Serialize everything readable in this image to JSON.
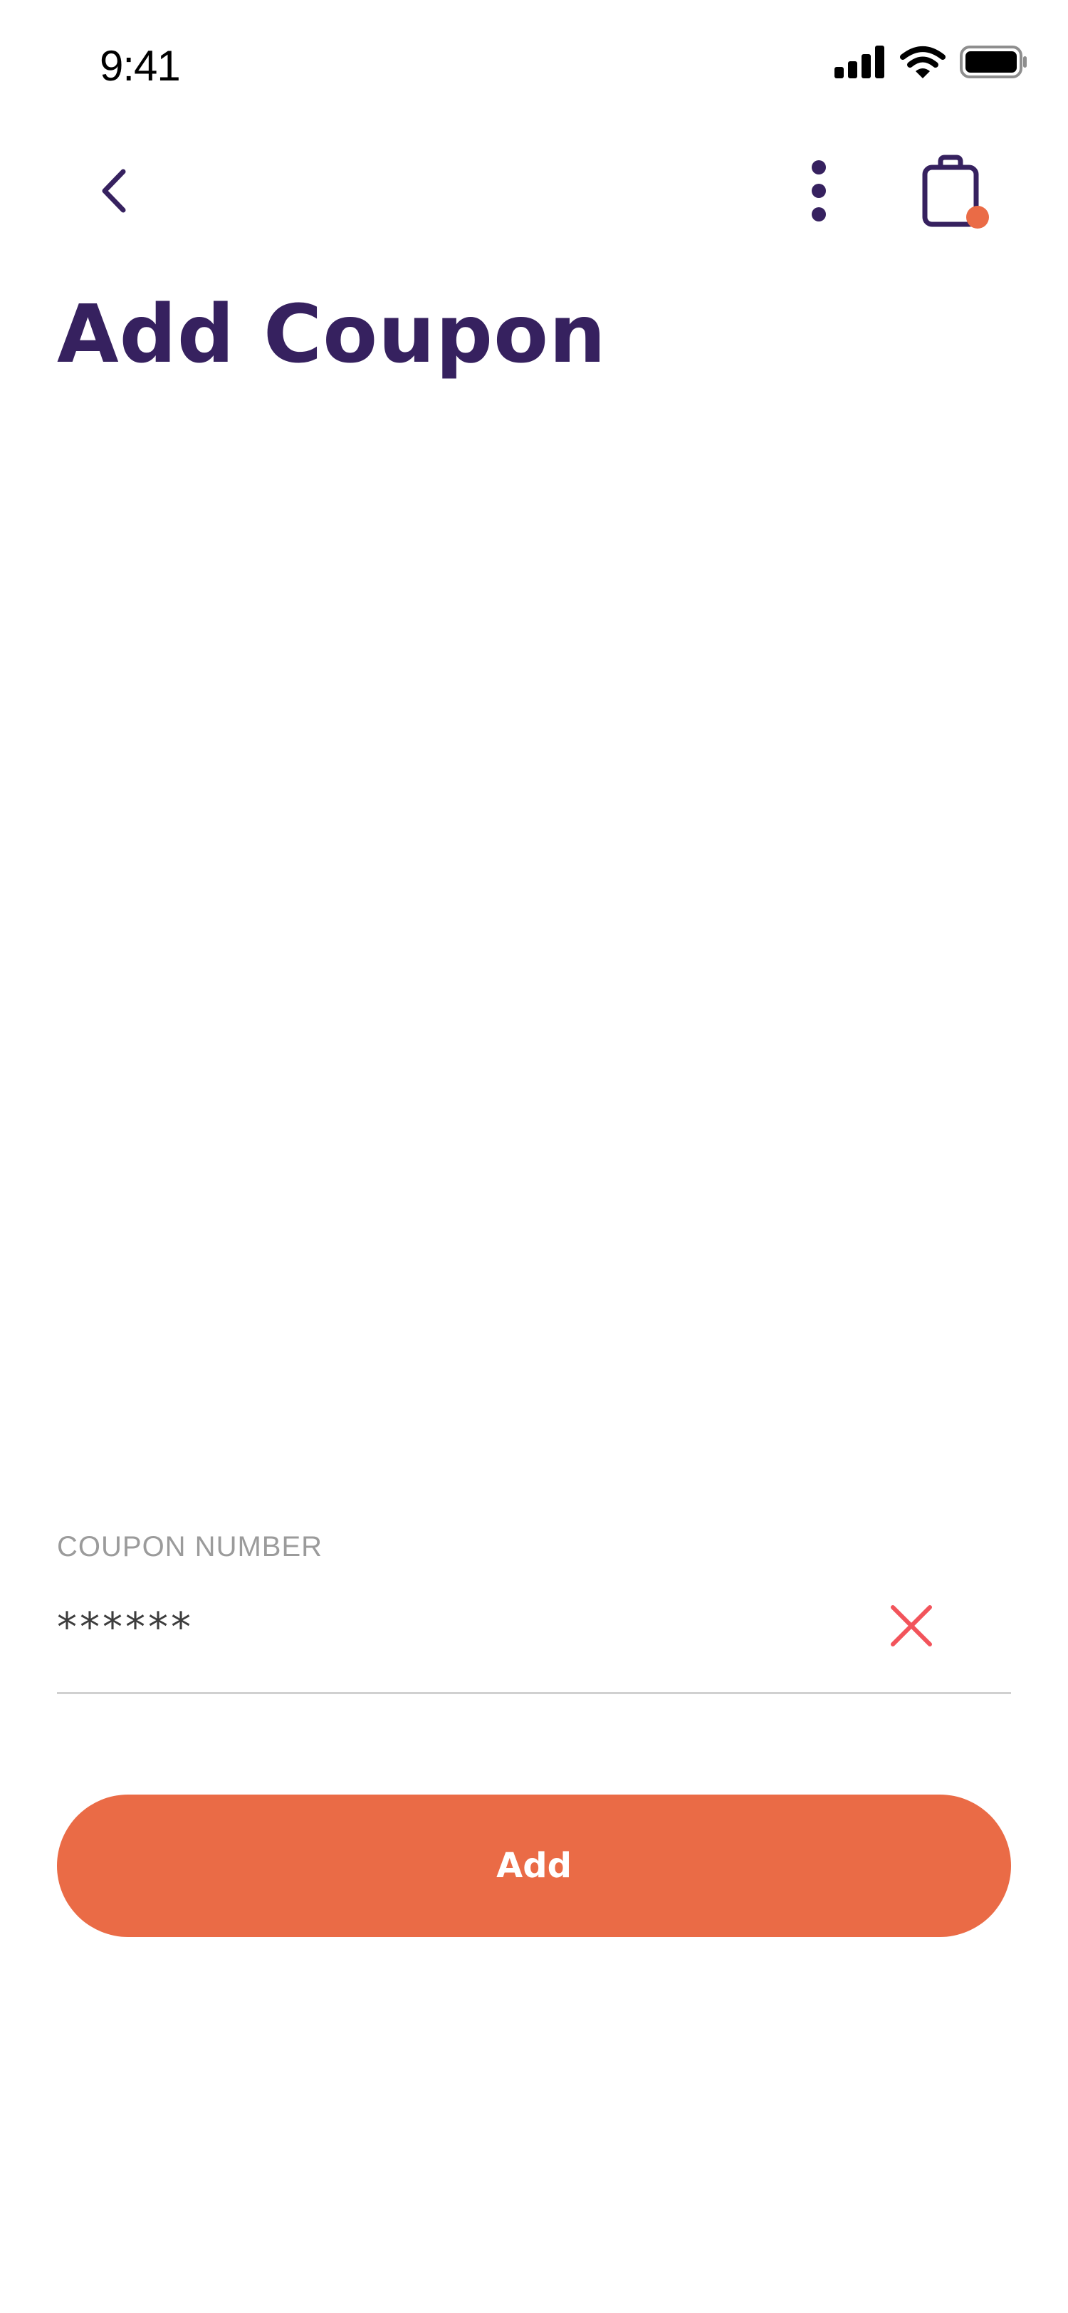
{
  "status_bar": {
    "time": "9:41",
    "signal_icon": "cellular-signal-icon",
    "wifi_icon": "wifi-icon",
    "battery_icon": "battery-icon"
  },
  "nav": {
    "back_icon": "chevron-left-icon",
    "more_icon": "more-vertical-icon",
    "bag_icon": "shopping-bag-icon",
    "bag_has_badge": true
  },
  "page": {
    "title": "Add Coupon"
  },
  "coupon_field": {
    "label": "COUPON NUMBER",
    "value": "******",
    "clear_icon": "close-icon"
  },
  "actions": {
    "add_label": "Add"
  },
  "colors": {
    "primary": "#36215f",
    "accent": "#ea6b46",
    "clear_icon": "#f2545b",
    "label": "#9b9b9b",
    "divider": "#d0d0d0"
  }
}
